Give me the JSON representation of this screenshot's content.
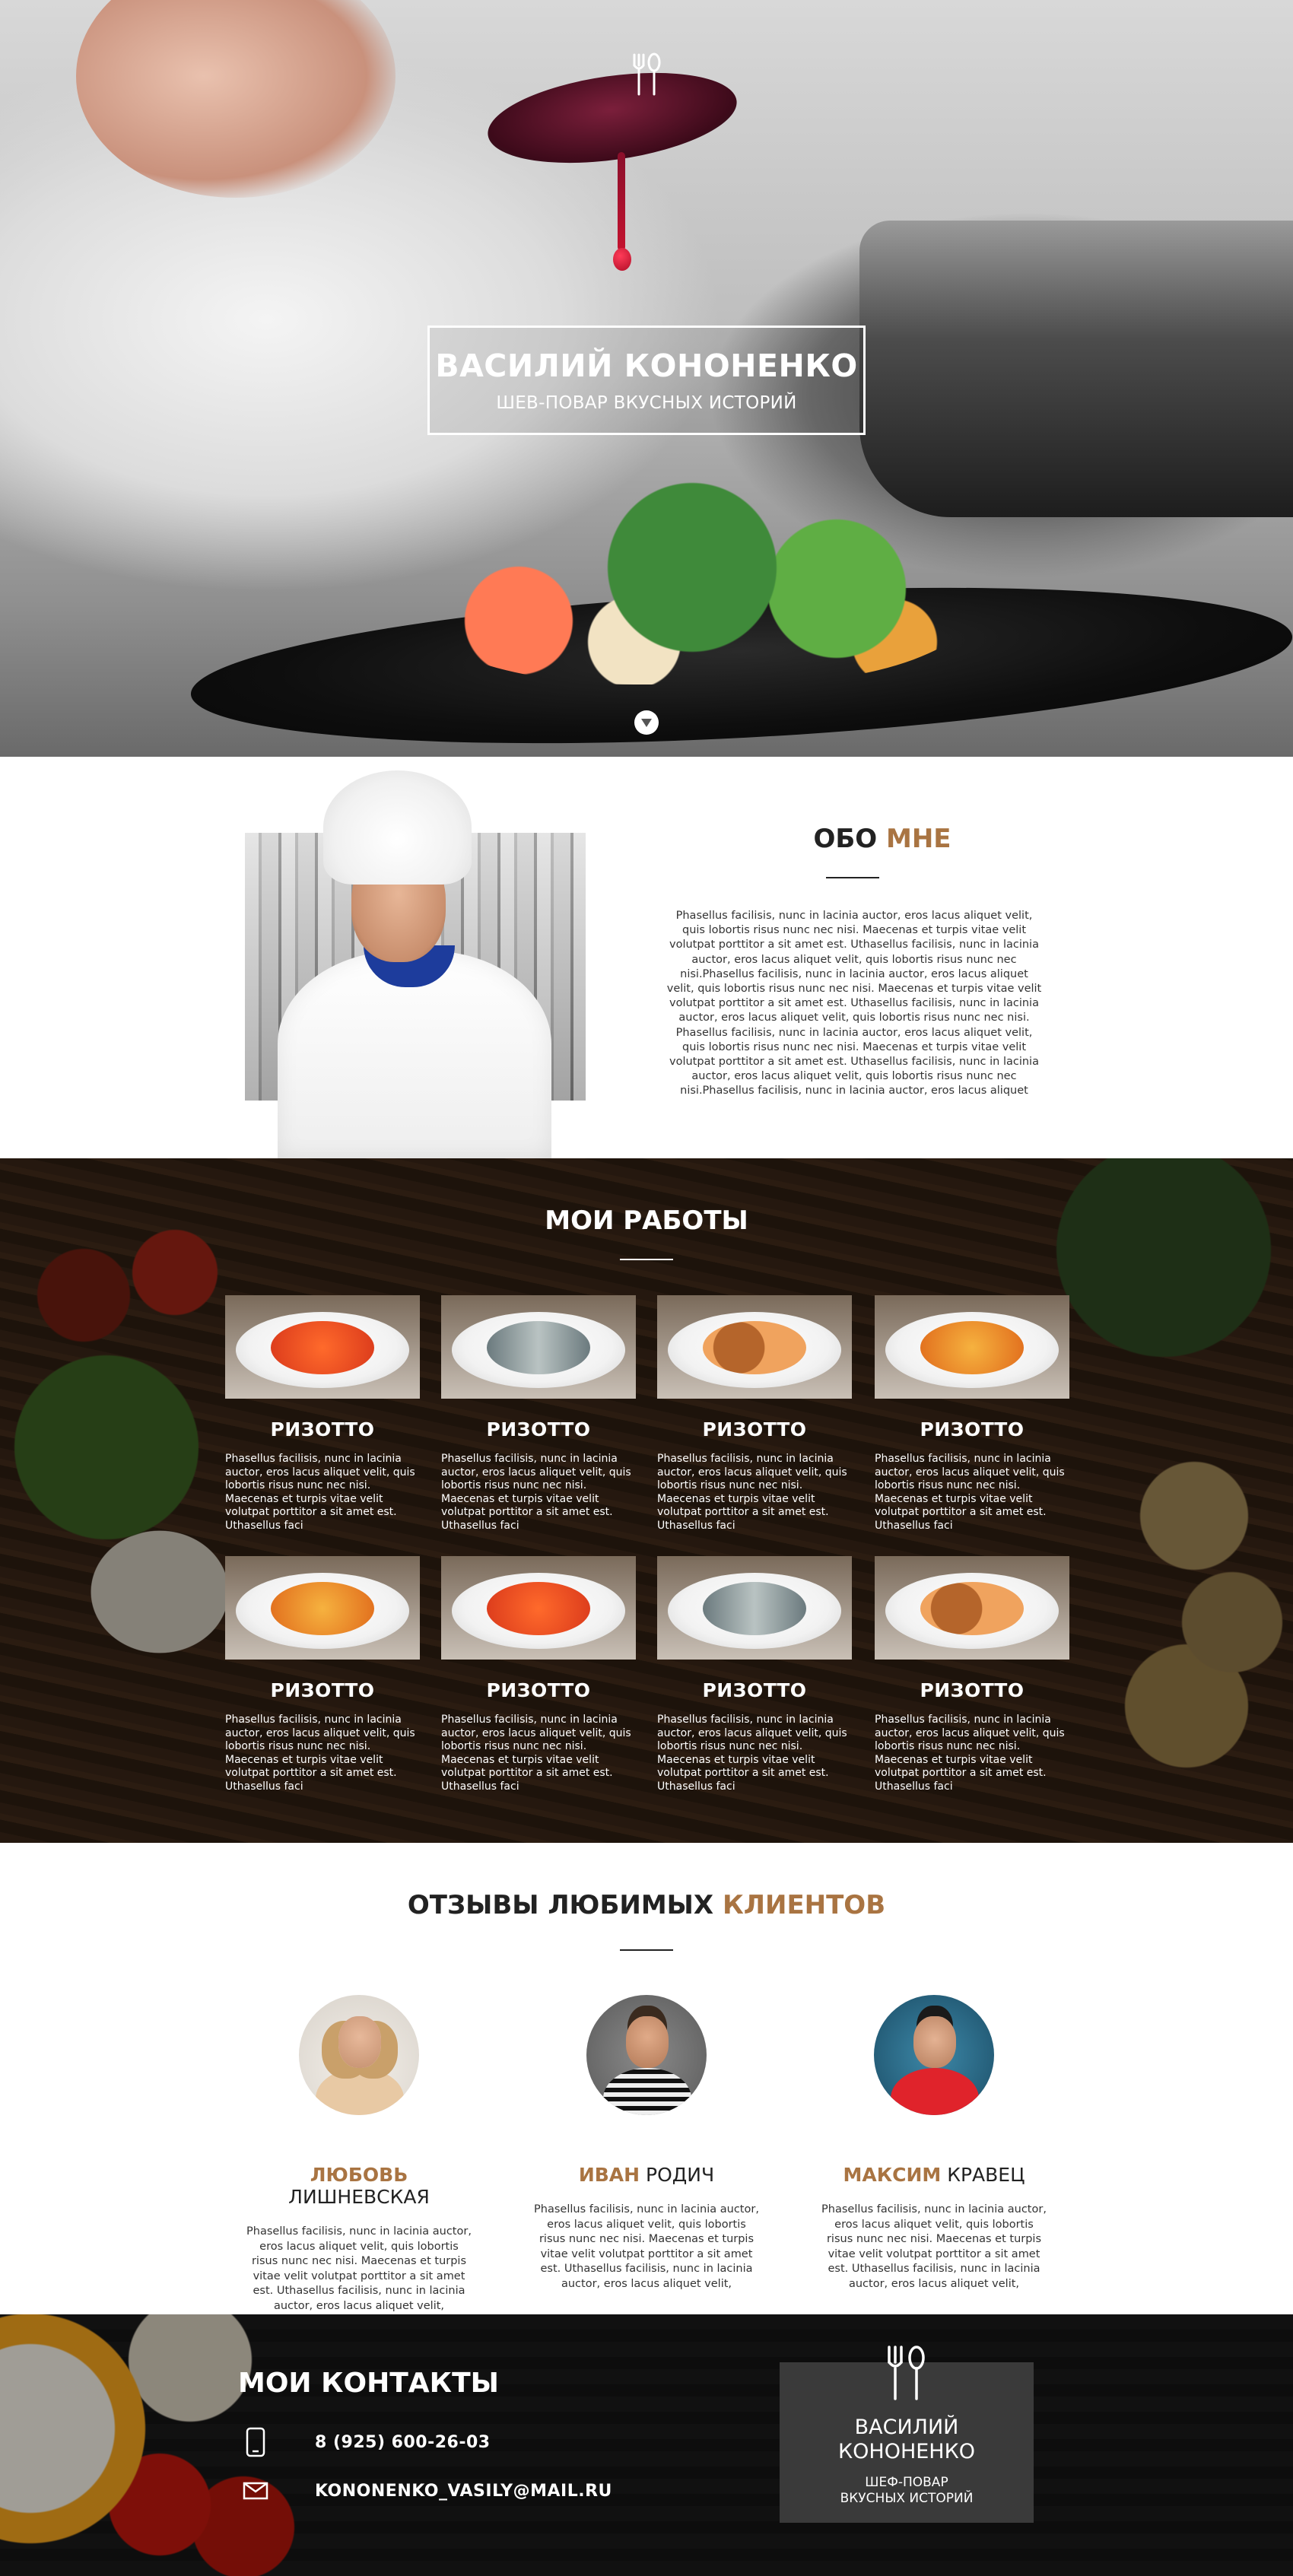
{
  "hero": {
    "title": "ВАСИЛИЙ КОНОНЕНКО",
    "subtitle": "ШЕВ-ПОВАР ВКУСНЫХ ИСТОРИЙ",
    "logo_icon": "fork-spoon-icon",
    "scroll_icon": "chevron-down-icon"
  },
  "about": {
    "heading_plain": "ОБО ",
    "heading_accent": "МНЕ",
    "text": "Phasellus facilisis, nunc in lacinia auctor, eros lacus aliquet velit, quis lobortis risus nunc nec nisi. Maecenas et turpis vitae velit volutpat porttitor a sit amet est. Uthasellus facilisis, nunc in lacinia auctor, eros lacus aliquet velit, quis lobortis risus nunc nec nisi.Phasellus facilisis, nunc in lacinia auctor, eros lacus aliquet velit, quis lobortis risus nunc nec nisi. Maecenas et turpis vitae velit volutpat porttitor a sit amet est. Uthasellus facilisis, nunc in lacinia auctor, eros lacus aliquet velit, quis lobortis risus nunc nec nisi. Phasellus facilisis, nunc in lacinia auctor, eros lacus aliquet velit, quis lobortis risus nunc nec nisi. Maecenas et turpis vitae velit volutpat porttitor a sit amet est. Uthasellus facilisis, nunc in lacinia auctor, eros lacus aliquet velit, quis lobortis risus nunc nec nisi.Phasellus facilisis, nunc in lacinia auctor, eros lacus aliquet"
  },
  "works": {
    "heading_plain": "МОИ ",
    "heading_bold": "РАБОТЫ",
    "items": [
      {
        "title": "РИЗОТТО",
        "text": "Phasellus facilisis, nunc in lacinia auctor, eros lacus aliquet velit, quis lobortis risus nunc nec nisi. Maecenas et turpis vitae velit volutpat porttitor a sit amet est. Uthasellus faci"
      },
      {
        "title": "РИЗОТТО",
        "text": "Phasellus facilisis, nunc in lacinia auctor, eros lacus aliquet velit, quis lobortis risus nunc nec nisi. Maecenas et turpis vitae velit volutpat porttitor a sit amet est. Uthasellus faci"
      },
      {
        "title": "РИЗОТТО",
        "text": "Phasellus facilisis, nunc in lacinia auctor, eros lacus aliquet velit, quis lobortis risus nunc nec nisi. Maecenas et turpis vitae velit volutpat porttitor a sit amet est. Uthasellus faci"
      },
      {
        "title": "РИЗОТТО",
        "text": "Phasellus facilisis, nunc in lacinia auctor, eros lacus aliquet velit, quis lobortis risus nunc nec nisi. Maecenas et turpis vitae velit volutpat porttitor a sit amet est. Uthasellus faci"
      },
      {
        "title": "РИЗОТТО",
        "text": "Phasellus facilisis, nunc in lacinia auctor, eros lacus aliquet velit, quis lobortis risus nunc nec nisi. Maecenas et turpis vitae velit volutpat porttitor a sit amet est. Uthasellus faci"
      },
      {
        "title": "РИЗОТТО",
        "text": "Phasellus facilisis, nunc in lacinia auctor, eros lacus aliquet velit, quis lobortis risus nunc nec nisi. Maecenas et turpis vitae velit volutpat porttitor a sit amet est. Uthasellus faci"
      },
      {
        "title": "РИЗОТТО",
        "text": "Phasellus facilisis, nunc in lacinia auctor, eros lacus aliquet velit, quis lobortis risus nunc nec nisi. Maecenas et turpis vitae velit volutpat porttitor a sit amet est. Uthasellus faci"
      },
      {
        "title": "РИЗОТТО",
        "text": "Phasellus facilisis, nunc in lacinia auctor, eros lacus aliquet velit, quis lobortis risus nunc nec nisi. Maecenas et turpis vitae velit volutpat porttitor a sit amet est. Uthasellus faci"
      }
    ]
  },
  "reviews": {
    "heading_plain": "ОТЗЫВЫ ЛЮБИМЫХ ",
    "heading_accent": "КЛИЕНТОВ",
    "items": [
      {
        "first": "ЛЮБОВЬ",
        "last": " ЛИШНЕВСКАЯ",
        "text": "Phasellus facilisis, nunc in lacinia auctor, eros lacus aliquet velit, quis lobortis risus nunc nec nisi. Maecenas et turpis vitae velit volutpat porttitor a sit amet est. Uthasellus facilisis, nunc in lacinia auctor, eros lacus aliquet velit,"
      },
      {
        "first": "ИВАН",
        "last": " РОДИЧ",
        "text": "Phasellus facilisis, nunc in lacinia auctor, eros lacus aliquet velit, quis lobortis risus nunc nec nisi. Maecenas et turpis vitae velit volutpat porttitor a sit amet est. Uthasellus facilisis, nunc in lacinia auctor, eros lacus aliquet velit,"
      },
      {
        "first": "МАКСИМ",
        "last": " КРАВЕЦ",
        "text": "Phasellus facilisis, nunc in lacinia auctor, eros lacus aliquet velit, quis lobortis risus nunc nec nisi. Maecenas et turpis vitae velit volutpat porttitor a sit amet est. Uthasellus facilisis, nunc in lacinia auctor, eros lacus aliquet velit,"
      }
    ]
  },
  "contacts": {
    "heading_plain": "МОИ ",
    "heading_bold": "КОНТАКТЫ",
    "phone": "8 (925) 600-26-03",
    "email": "KONONENKO_VASILY@MAIL.RU",
    "phone_icon": "phone-icon",
    "email_icon": "envelope-icon",
    "card": {
      "name_line1": "ВАСИЛИЙ",
      "name_line2": "КОНОНЕНКО",
      "sub_line1": "ШЕФ-ПОВАР",
      "sub_line2": "ВКУСНЫХ ИСТОРИЙ",
      "icon": "fork-spoon-icon"
    }
  },
  "colors": {
    "accent": "#a97442",
    "card_bg": "#3a3a3a"
  }
}
